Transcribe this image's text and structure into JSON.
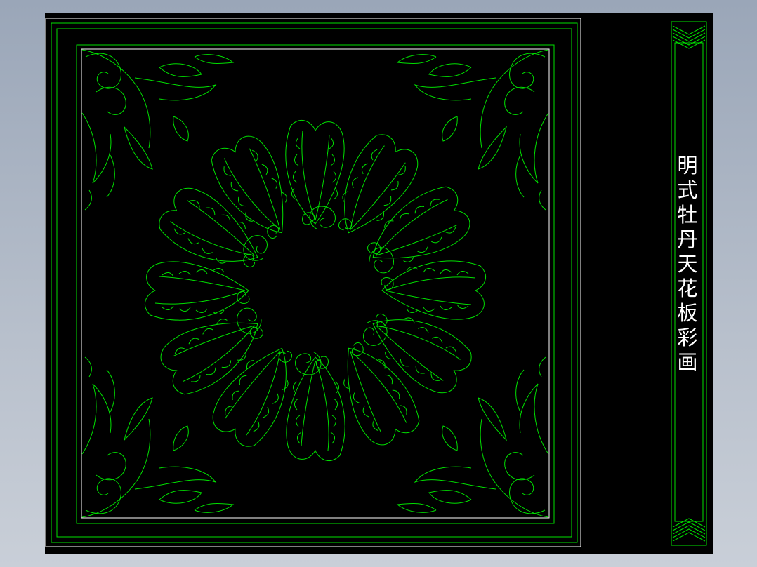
{
  "drawing": {
    "title": "明式牡丹天花板彩画",
    "colors": {
      "background": "#000000",
      "frame": "#ffffff",
      "linework": "#00ff00",
      "text": "#ffffff"
    },
    "motif": "peony-rosette-with-corner-scrolls"
  }
}
